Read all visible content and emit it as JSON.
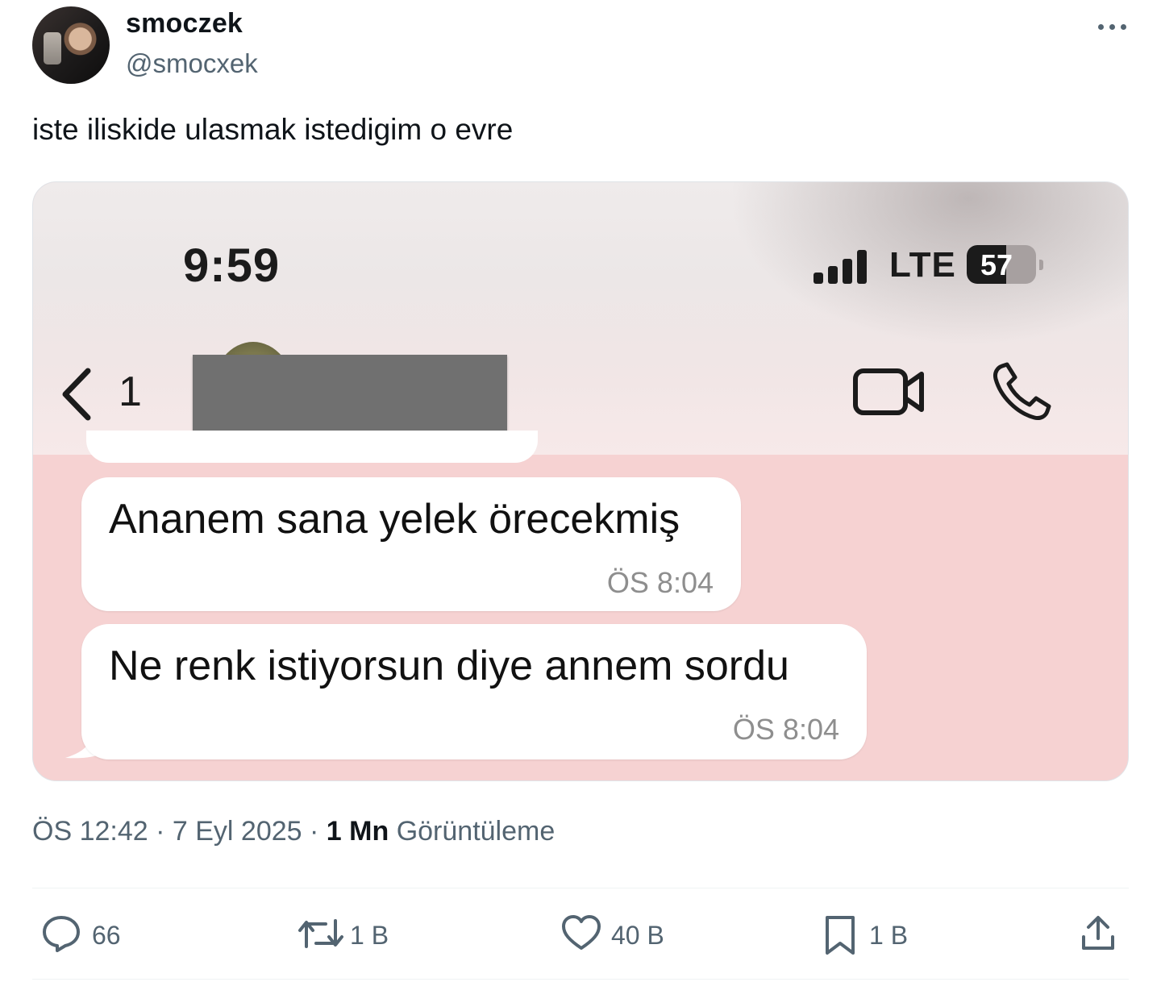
{
  "author": {
    "name": "smoczek",
    "handle": "@smocxek"
  },
  "tweet": {
    "text": "iste iliskide ulasmak istedigim o evre"
  },
  "screenshot": {
    "status_time": "9:59",
    "network": "LTE",
    "battery": "57",
    "battery_level": 0.57,
    "back_count": "1",
    "messages": [
      {
        "text": "Ananem sana yelek örecekmiş",
        "time": "ÖS 8:04"
      },
      {
        "text": "Ne renk istiyorsun diye annem sordu",
        "time": "ÖS 8:04"
      }
    ]
  },
  "meta": {
    "time": "ÖS 12:42",
    "date": "7 Eyl 2025",
    "views_count": "1 Mn",
    "views_label": "Görüntüleme",
    "separator": "·"
  },
  "actions": {
    "replies": "66",
    "reposts": "1 B",
    "likes": "40 B",
    "bookmarks": "1 B"
  },
  "icons": [
    "more-icon",
    "back-icon",
    "video-call-icon",
    "phone-call-icon",
    "reply-icon",
    "repost-icon",
    "like-icon",
    "bookmark-icon",
    "share-icon"
  ],
  "colors": {
    "chat_background": "#f6d2d2",
    "bubble": "#ffffff",
    "secondary_text": "#536471"
  }
}
